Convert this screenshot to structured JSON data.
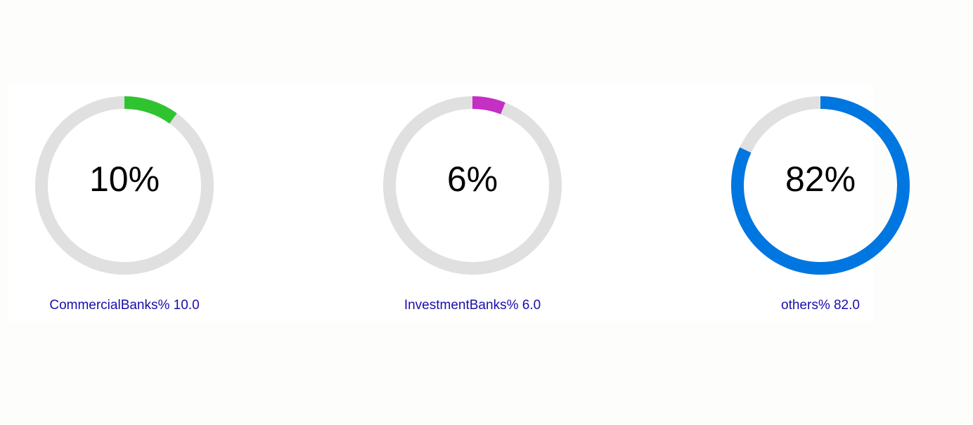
{
  "chart_data": {
    "type": "gauge",
    "track_color": "#e0e0e0",
    "gauges": [
      {
        "name": "CommercialBanks",
        "value": 10,
        "value_text": "10%",
        "label": "CommercialBanks% 10.0",
        "color": "#2fc42f"
      },
      {
        "name": "InvestmentBanks",
        "value": 6,
        "value_text": "6%",
        "label": "InvestmentBanks% 6.0",
        "color": "#c42fc4"
      },
      {
        "name": "others",
        "value": 82,
        "value_text": "82%",
        "label": "others% 82.0",
        "color": "#0076e0"
      }
    ]
  }
}
